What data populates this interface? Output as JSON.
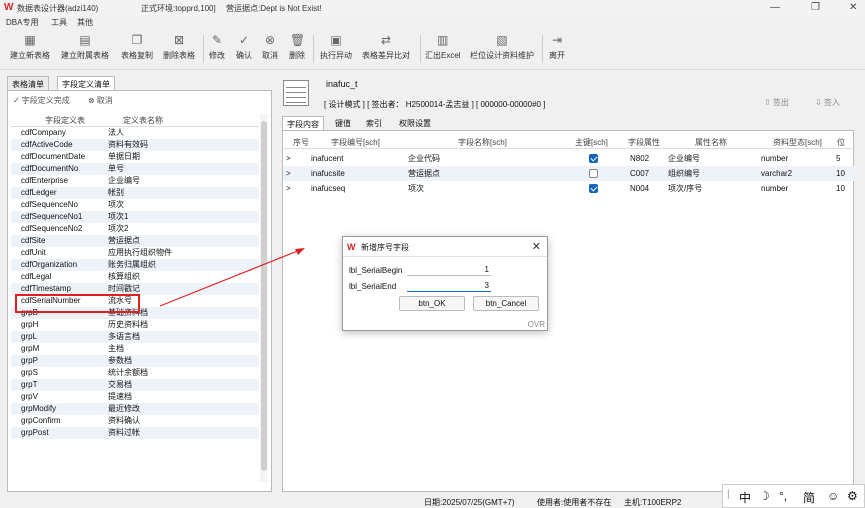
{
  "window": {
    "title": "数据表设计器(adzi140)",
    "env": "正式环境:topprd,100]",
    "site": "营运据点:Dept is Not Exist!"
  },
  "menu": [
    "DBA专用",
    "工具",
    "其他"
  ],
  "toolbar": [
    "建立新表格",
    "建立附属表格",
    "表格复制",
    "删除表格",
    "修改",
    "确认",
    "取消",
    "删除",
    "执行异动",
    "表格差异比对",
    "汇出Excel",
    "栏位设计资料维护",
    "离开"
  ],
  "left": {
    "tabs": [
      "表格清单",
      "字段定义清单"
    ],
    "done_label": "字段定义完成",
    "cancel_label": "取消",
    "columns": [
      "字段定义表",
      "定义表名称"
    ],
    "rows": [
      [
        "cdfCompany",
        "法人"
      ],
      [
        "cdfActiveCode",
        "资料有效码"
      ],
      [
        "cdfDocumentDate",
        "单据日期"
      ],
      [
        "cdfDocumentNo",
        "单号"
      ],
      [
        "cdfEnterprise",
        "企业编号"
      ],
      [
        "cdfLedger",
        "帐别"
      ],
      [
        "cdfSequenceNo",
        "项次"
      ],
      [
        "cdfSequenceNo1",
        "项次1"
      ],
      [
        "cdfSequenceNo2",
        "项次2"
      ],
      [
        "cdfSite",
        "营运据点"
      ],
      [
        "cdfUnit",
        "应用执行组织物件"
      ],
      [
        "cdfOrganization",
        "账务归属组织"
      ],
      [
        "cdfLegal",
        "核算组织"
      ],
      [
        "cdfTimestamp",
        "时间戳记"
      ],
      [
        "cdfSerialNumber",
        "流水号"
      ],
      [
        "grpB",
        "基础资料档"
      ],
      [
        "grpH",
        "历史资料档"
      ],
      [
        "grpL",
        "多语言档"
      ],
      [
        "grpM",
        "主档"
      ],
      [
        "grpP",
        "参数档"
      ],
      [
        "grpS",
        "统计余额档"
      ],
      [
        "grpT",
        "交易档"
      ],
      [
        "grpV",
        "提速档"
      ],
      [
        "grpModify",
        "最近修改"
      ],
      [
        "grpConfirm",
        "资料确认"
      ],
      [
        "grpPost",
        "资料过帐"
      ]
    ]
  },
  "table": {
    "name": "inafuc_t",
    "info": "[ 设计模式 ] [ 签出者： H2500014-孟志益 ] [ 000000-00000#0 ]",
    "checkout": "签出",
    "checkin": "签入"
  },
  "right": {
    "tabs": [
      "字段内容",
      "键值",
      "索引",
      "权限设置"
    ],
    "columns": [
      "序号",
      "字段编号[sch]",
      "字段名称[sch]",
      "主键[sch]",
      "字段属性",
      "属性名称",
      "资料型态[sch]",
      "位"
    ],
    "rows": [
      {
        "mark": ">",
        "id": "inafucent",
        "name": "企业代码",
        "pk": true,
        "attr": "N802",
        "attr_name": "企业编号",
        "type": "number",
        "len": "5"
      },
      {
        "mark": ">",
        "id": "inafucsite",
        "name": "营运据点",
        "pk": false,
        "attr": "C007",
        "attr_name": "组织编号",
        "type": "varchar2",
        "len": "10"
      },
      {
        "mark": ">",
        "id": "inafucseq",
        "name": "项次",
        "pk": true,
        "attr": "N004",
        "attr_name": "项次/序号",
        "type": "number",
        "len": "10"
      }
    ]
  },
  "dialog": {
    "title": "新增序号字段",
    "begin_label": "lbl_SerialBegin",
    "begin_value": "1",
    "end_label": "lbl_SerialEnd",
    "end_value": "3",
    "ok": "btn_OK",
    "cancel": "btn_Cancel",
    "ovr": "OVR"
  },
  "status": {
    "date": "日期:2025/07/25(GMT+7)",
    "user": "使用者:使用者不存在",
    "host": "主机:T100ERP2"
  },
  "ime": {
    "lang": "中",
    "punct": "°,",
    "simp": "简"
  },
  "colors": {
    "accent": "#1565c0",
    "highlight": "#e02020",
    "brand": "#d0262b"
  }
}
